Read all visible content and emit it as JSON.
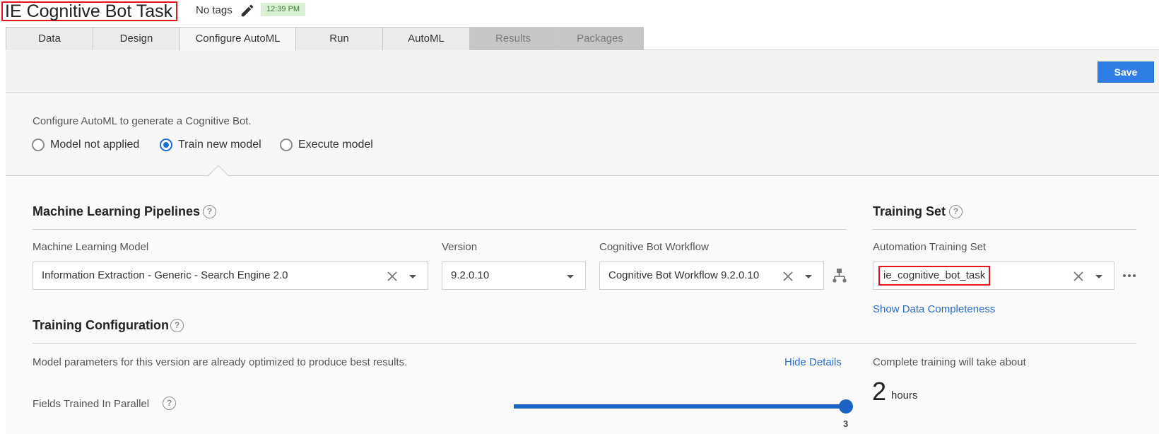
{
  "header": {
    "title": "IE Cognitive Bot Task",
    "tags": "No tags",
    "time": "12:39 PM"
  },
  "tabs": [
    {
      "label": "Data",
      "state": "normal"
    },
    {
      "label": "Design",
      "state": "normal"
    },
    {
      "label": "Configure AutoML",
      "state": "active"
    },
    {
      "label": "Run",
      "state": "normal"
    },
    {
      "label": "AutoML",
      "state": "normal"
    },
    {
      "label": "Results",
      "state": "disabled"
    },
    {
      "label": "Packages",
      "state": "disabled"
    }
  ],
  "toolbar": {
    "save_label": "Save"
  },
  "config": {
    "description": "Configure AutoML to generate a Cognitive Bot.",
    "options": [
      {
        "label": "Model not applied",
        "selected": false
      },
      {
        "label": "Train new model",
        "selected": true
      },
      {
        "label": "Execute model",
        "selected": false
      }
    ]
  },
  "pipelines": {
    "heading": "Machine Learning Pipelines",
    "model_label": "Machine Learning Model",
    "model_value": "Information Extraction - Generic - Search Engine 2.0",
    "version_label": "Version",
    "version_value": "9.2.0.10",
    "workflow_label": "Cognitive Bot Workflow",
    "workflow_value": "Cognitive Bot Workflow 9.2.0.10"
  },
  "training_set": {
    "heading": "Training Set",
    "label": "Automation Training Set",
    "value": "ie_cognitive_bot_task",
    "completeness_link": "Show Data Completeness"
  },
  "training_config": {
    "heading": "Training Configuration",
    "description": "Model parameters for this version are already optimized to produce best results.",
    "hide_details_link": "Hide Details",
    "fields_label": "Fields Trained In Parallel",
    "fields_value": "3",
    "fields_slider_fraction": 1.0
  },
  "estimate": {
    "label": "Complete training will take about",
    "number": "2",
    "unit": "hours"
  },
  "colors": {
    "accent": "#1d63c2",
    "save_button": "#2e7ee3",
    "highlight_box": "#e3141b",
    "time_badge_bg": "#d9f0d4"
  }
}
